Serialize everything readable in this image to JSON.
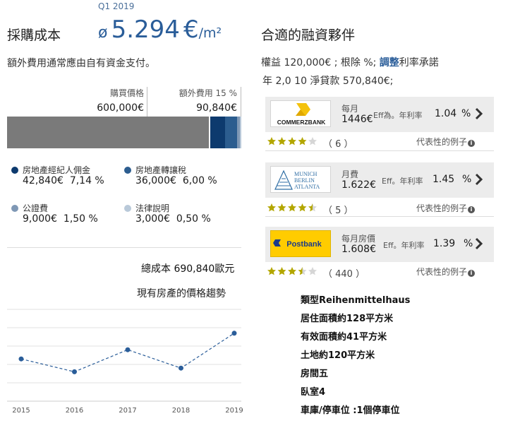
{
  "acquisition": {
    "quarter": "Q1 2019",
    "title": "採購成本",
    "price_symbol": "ø",
    "price_value": "5.294",
    "price_currency": "€",
    "price_unit": "/m²",
    "note": "額外費用通常應由自有資金支付。",
    "purchase_label": "購買價格",
    "purchase_value": "600,000€",
    "extras_label": "額外費用 15 %",
    "extras_value": "90,840€",
    "bar_shares": {
      "purchase": 0.8685,
      "broker": 0.062,
      "transfer_tax": 0.052,
      "notary": 0.013,
      "legal": 0.0045
    },
    "colors": {
      "purchase": "#7a7a7a",
      "broker": "#0d3a6e",
      "transfer_tax": "#2c5d8f",
      "notary": "#7f98b5",
      "legal": "#b9c9d9"
    },
    "legend": [
      {
        "label": "房地產經紀人佣金",
        "amount": "42,840€",
        "percent": "7,14 %"
      },
      {
        "label": "房地產轉讓稅",
        "amount": "36,000€",
        "percent": "6,00 %"
      },
      {
        "label": "公證費",
        "amount": "9,000€",
        "percent": "1,50 %"
      },
      {
        "label": "法律說明",
        "amount": "3,000€",
        "percent": "0,50 %"
      }
    ],
    "total": "總成本 690,840歐元",
    "trend_title": "現有房產的價格趨勢"
  },
  "chart_data": {
    "type": "line",
    "title": "現有房產的價格趨勢",
    "categories": [
      "2015",
      "2016",
      "2017",
      "2018",
      "2019"
    ],
    "values": [
      4.6,
      3.2,
      5.6,
      3.6,
      7.4
    ],
    "ylim": [
      0,
      10
    ],
    "grid": true,
    "color": "#2a5d99"
  },
  "financing": {
    "title": "合適的融資夥伴",
    "line1_before": "權益 120,000€ ; 根除   %;",
    "line1_link": "調整",
    "line1_after": "利率承諾",
    "line2": "年   2,0 10   淨貸款  570,840€;",
    "offers": [
      {
        "bank": "COMMERZBANK",
        "rate_label": "每月",
        "monthly": "1446€",
        "eff_label": "Eff為。年利率",
        "eff_rate": "1.04",
        "pct": "%",
        "rating": 4,
        "count": "（ 6 ）",
        "example": "代表性的例子"
      },
      {
        "bank_lines": [
          "MUNICH",
          "BERLIN",
          "ATLANTA"
        ],
        "rate_label": "月費",
        "monthly": "1.622€",
        "eff_label": "Eff。年利率",
        "eff_rate": "1.45",
        "pct": "%",
        "rating": 4.5,
        "count": "（ 5 ）",
        "example": "代表性的例子"
      },
      {
        "bank": "Postbank",
        "rate_label": "每月房價",
        "monthly": "1.608€",
        "eff_label": "Eff。年利率",
        "eff_rate": "1.39",
        "pct": "%",
        "rating": 3.5,
        "count": "（ 440 ）",
        "example": "代表性的例子"
      }
    ]
  },
  "property": [
    "類型Reihenmittelhaus",
    "居住面積約128平方米",
    "有效面積約41平方米",
    "土地約120平方米",
    "房間五",
    "臥室4",
    "車庫/停車位  :1個停車位"
  ]
}
